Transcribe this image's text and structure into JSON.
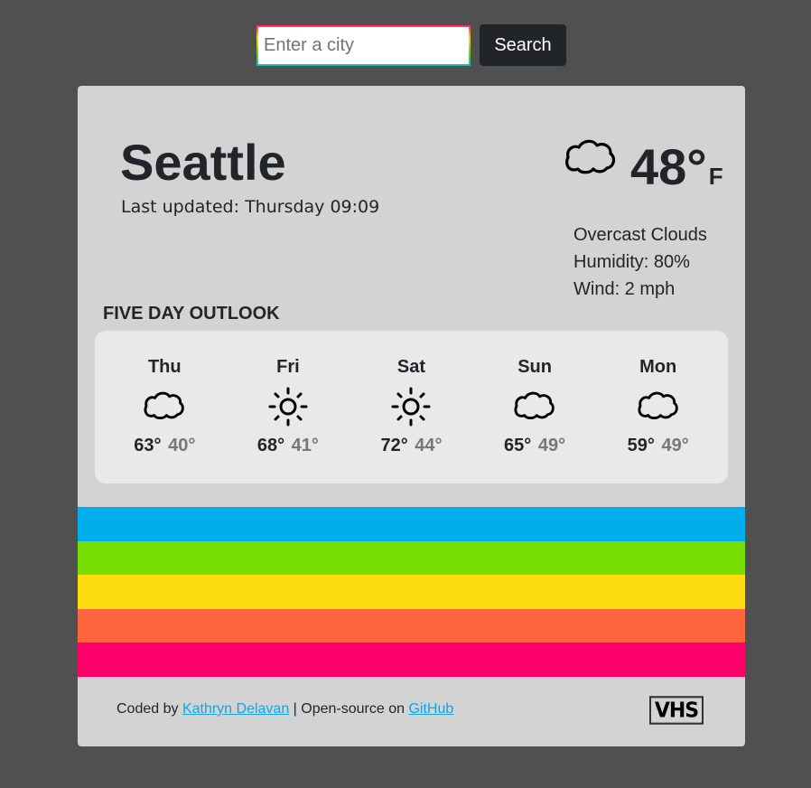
{
  "search": {
    "placeholder": "Enter a city",
    "value": "",
    "button_label": "Search"
  },
  "current": {
    "city": "Seattle",
    "last_updated": "Last updated: Thursday 09:09",
    "icon": "cloud-icon",
    "temperature": "48°",
    "unit": "F",
    "description": "Overcast Clouds",
    "humidity": "Humidity: 80%",
    "wind": "Wind: 2 mph"
  },
  "outlook": {
    "title": "FIVE DAY OUTLOOK",
    "days": [
      {
        "name": "Thu",
        "icon": "cloud-icon",
        "high": "63°",
        "low": "40°"
      },
      {
        "name": "Fri",
        "icon": "sun-icon",
        "high": "68°",
        "low": "41°"
      },
      {
        "name": "Sat",
        "icon": "sun-icon",
        "high": "72°",
        "low": "44°"
      },
      {
        "name": "Sun",
        "icon": "cloud-icon",
        "high": "65°",
        "low": "49°"
      },
      {
        "name": "Mon",
        "icon": "cloud-icon",
        "high": "59°",
        "low": "49°"
      }
    ]
  },
  "stripes": [
    "#01AEEB",
    "#78DD00",
    "#FCDD10",
    "#FF6640",
    "#FF006A"
  ],
  "footer": {
    "prefix": "Coded by ",
    "author_link": "Kathryn Delavan",
    "middle": " | Open-source on ",
    "github_link": "GitHub",
    "logo_text": "VHS"
  }
}
